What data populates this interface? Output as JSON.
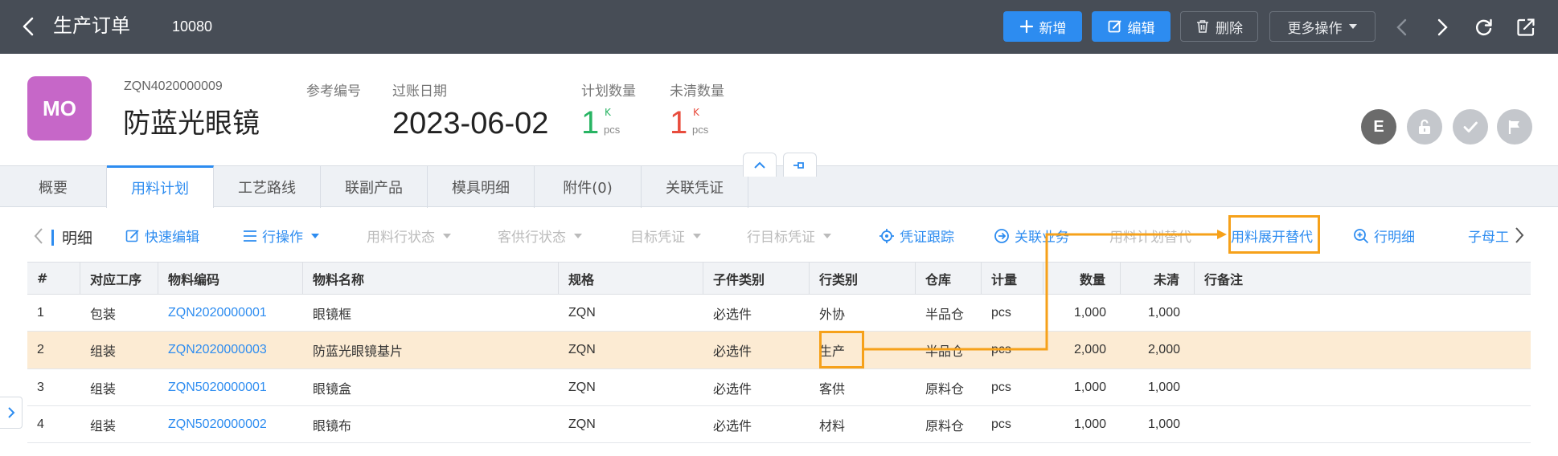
{
  "topbar": {
    "title": "生产订单",
    "order_no": "10080",
    "buttons": {
      "add": "新增",
      "edit": "编辑",
      "delete": "删除",
      "more": "更多操作"
    }
  },
  "header": {
    "avatar_text": "MO",
    "doc_code": "ZQN4020000009",
    "product_name": "防蓝光眼镜",
    "ref_label": "参考编号",
    "post_date_label": "过账日期",
    "post_date": "2023-06-02",
    "plan_qty_label": "计划数量",
    "plan_qty": "1",
    "plan_qty_k": "K",
    "plan_qty_unit": "pcs",
    "open_qty_label": "未清数量",
    "open_qty": "1",
    "open_qty_k": "K",
    "open_qty_unit": "pcs",
    "status_e": "E"
  },
  "tabs": [
    "概要",
    "用料计划",
    "工艺路线",
    "联副产品",
    "模具明细",
    "附件(0)",
    "关联凭证"
  ],
  "active_tab": 1,
  "toolbar": {
    "detail": "明细",
    "quick_edit": "快速编辑",
    "row_ops": "行操作",
    "material_row_status": "用料行状态",
    "customer_row_status": "客供行状态",
    "target_voucher": "目标凭证",
    "row_target_voucher": "行目标凭证",
    "voucher_trace": "凭证跟踪",
    "related_biz": "关联业务",
    "material_plan_replace": "用料计划替代",
    "expand_replace": "用料展开替代",
    "row_detail": "行明细",
    "sub_parent": "子母工"
  },
  "table": {
    "columns": [
      "#",
      "对应工序",
      "物料编码",
      "物料名称",
      "规格",
      "子件类别",
      "行类别",
      "仓库",
      "计量",
      "数量",
      "未清",
      "行备注"
    ],
    "rows": [
      [
        "1",
        "包装",
        "ZQN2020000001",
        "眼镜框",
        "ZQN",
        "必选件",
        "外协",
        "半品仓",
        "pcs",
        "1,000",
        "1,000",
        ""
      ],
      [
        "2",
        "组装",
        "ZQN2020000003",
        "防蓝光眼镜基片",
        "ZQN",
        "必选件",
        "生产",
        "半品仓",
        "pcs",
        "2,000",
        "2,000",
        ""
      ],
      [
        "3",
        "组装",
        "ZQN5020000001",
        "眼镜盒",
        "ZQN",
        "必选件",
        "客供",
        "原料仓",
        "pcs",
        "1,000",
        "1,000",
        ""
      ],
      [
        "4",
        "组装",
        "ZQN5020000002",
        "眼镜布",
        "ZQN",
        "必选件",
        "材料",
        "原料仓",
        "pcs",
        "1,000",
        "1,000",
        ""
      ]
    ],
    "selected_row": 1
  },
  "colors": {
    "accent": "#2d8cf0",
    "highlight": "#f6a11a",
    "topbar": "#474d56",
    "selected_row": "#fcebd3"
  }
}
